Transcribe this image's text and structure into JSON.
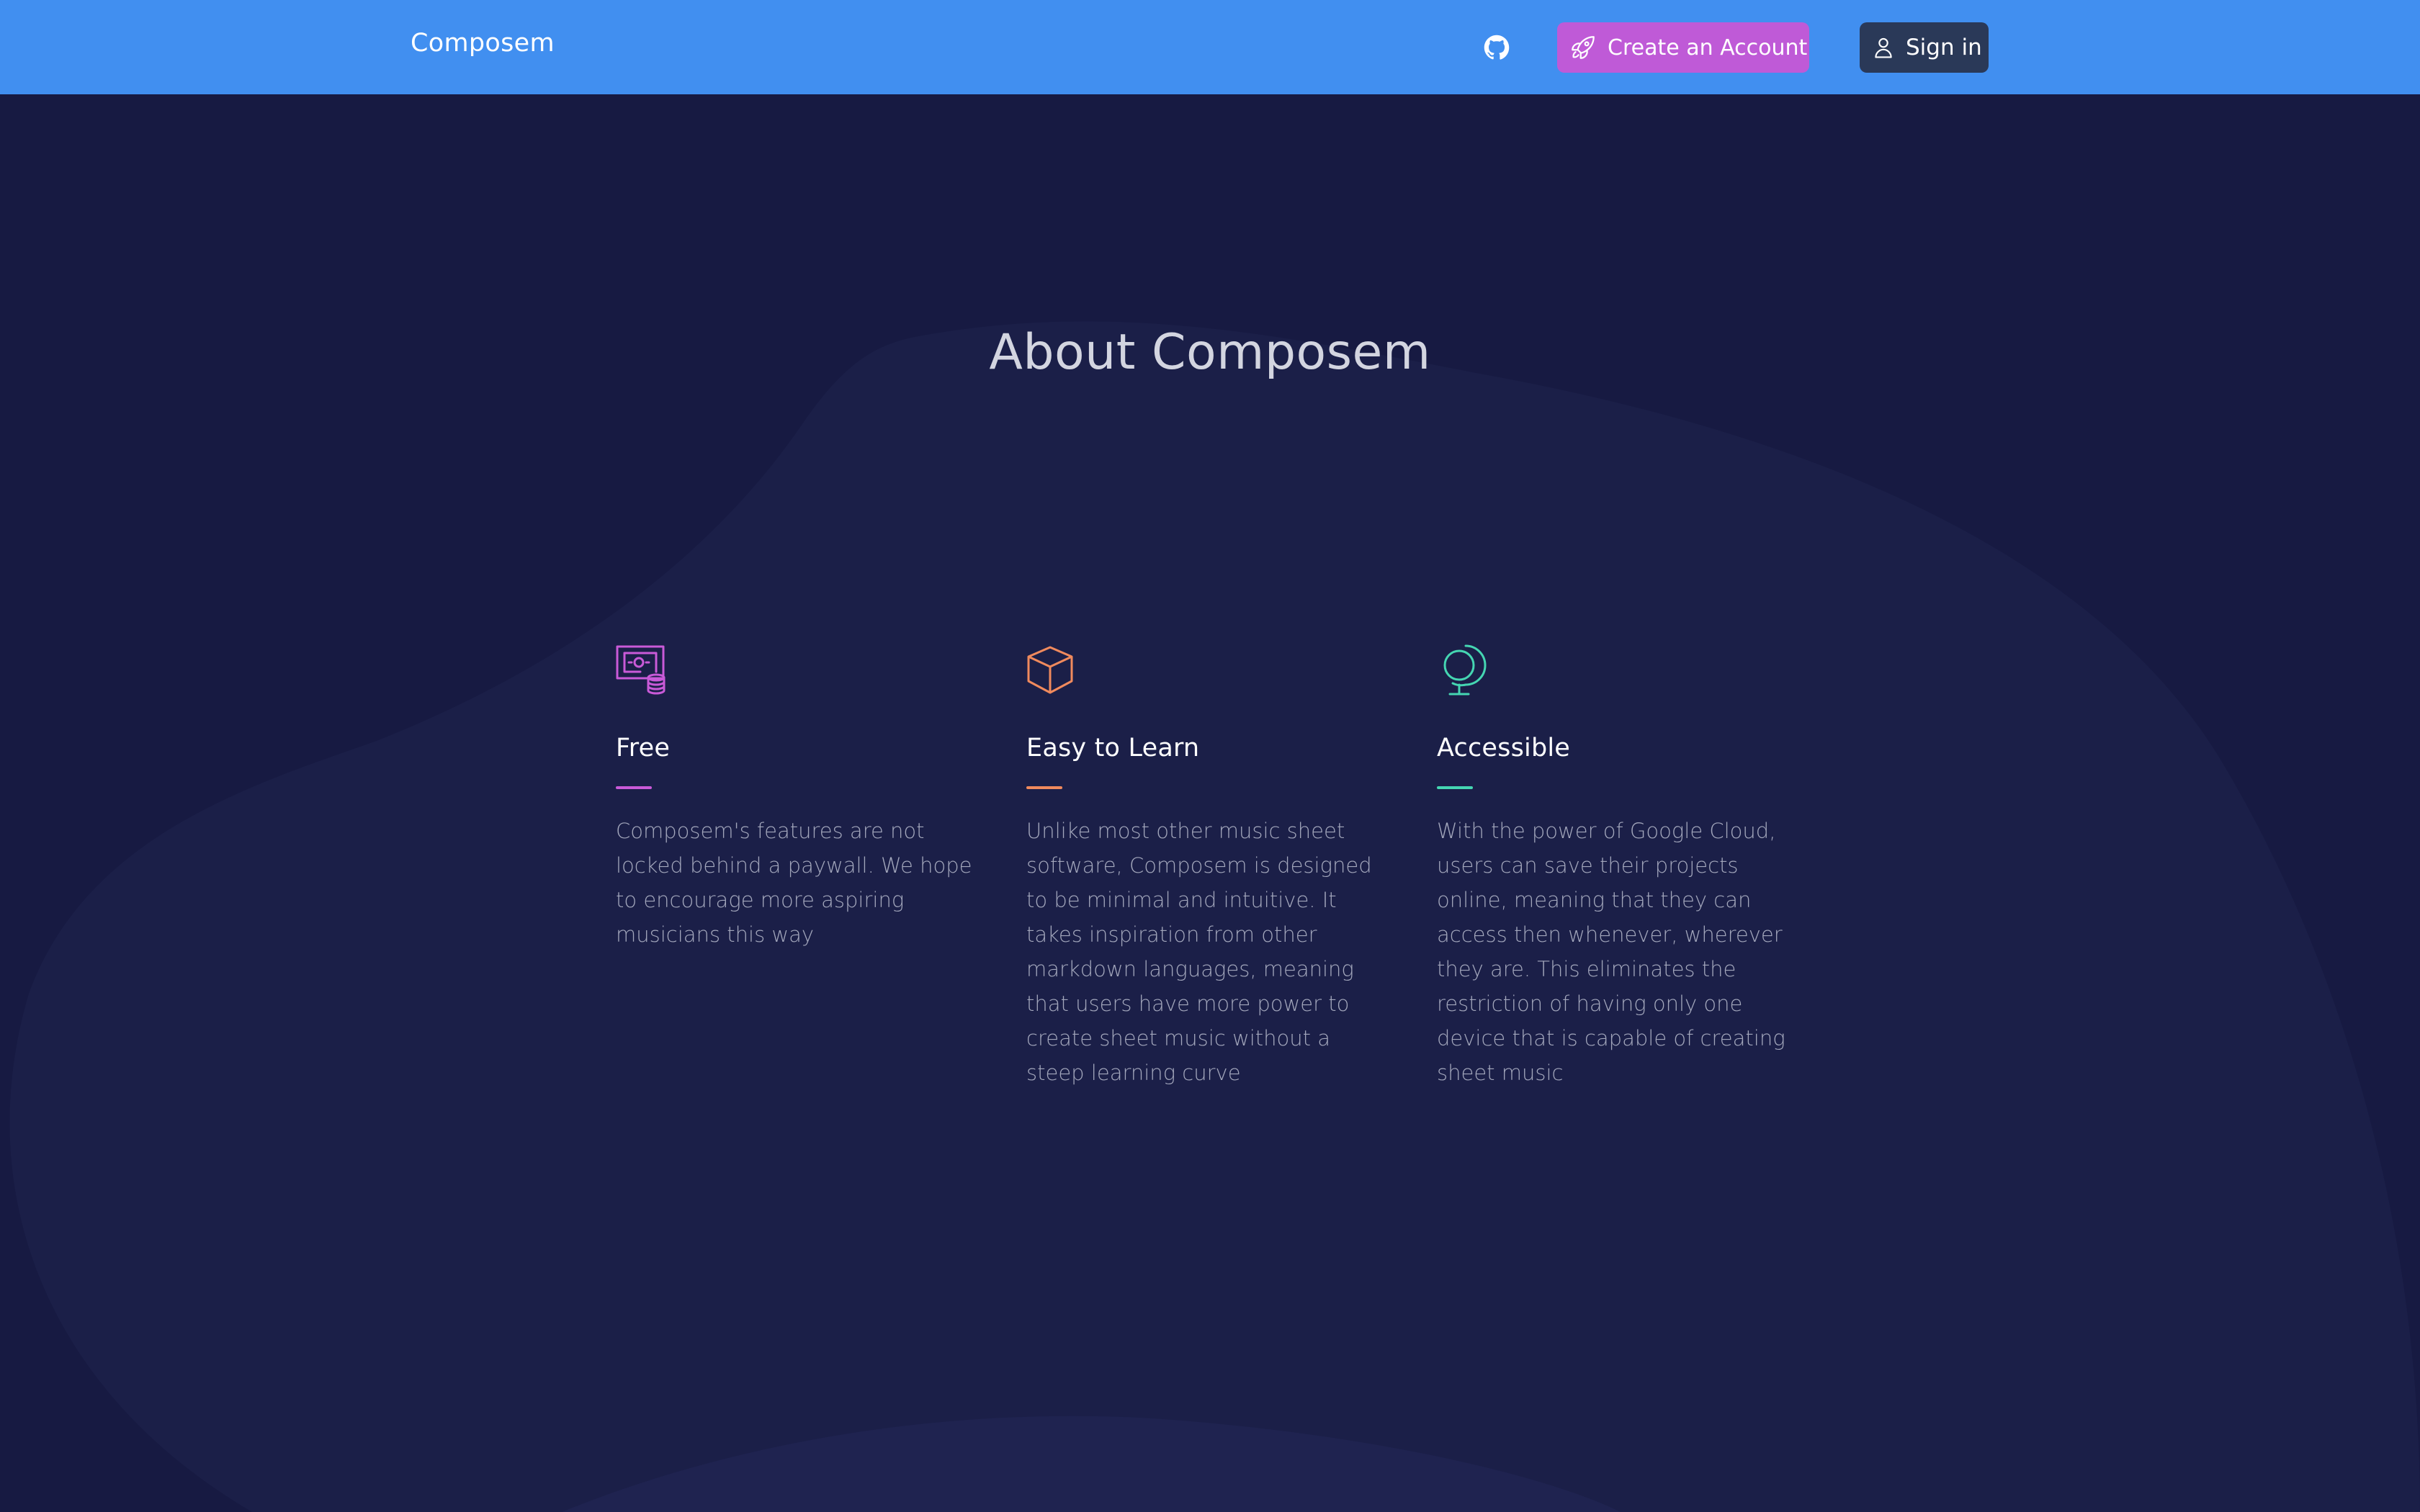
{
  "nav": {
    "brand": "Composem",
    "create_account_label": "Create an Account",
    "sign_in_label": "Sign in",
    "github_icon": "github-icon",
    "create_icon": "rocket-icon",
    "sign_in_icon": "user-icon"
  },
  "about": {
    "title": "About Composem",
    "features": [
      {
        "title": "Free",
        "text": "Composem's features are not locked behind a paywall. We hope to encourage more aspiring musicians this way",
        "icon": "cash-icon",
        "accent": "#c95ad8"
      },
      {
        "title": "Easy to Learn",
        "text": "Unlike most other music sheet software, Composem is designed to be minimal and intuitive. It takes inspiration from other markdown languages, meaning that users have more power to create sheet music without a steep learning curve",
        "icon": "cube-icon",
        "accent": "#f08a5d"
      },
      {
        "title": "Accessible",
        "text": "With the power of Google Cloud, users can save their projects online, meaning that they can access then whenever, wherever they are. This eliminates the restriction of having only one device that is capable of creating sheet music",
        "icon": "globe-icon",
        "accent": "#45d6b2"
      }
    ]
  },
  "colors": {
    "header_bg": "#418ff0",
    "page_bg": "#171a42",
    "create_button": "#bf5ad7",
    "sign_in_button": "#2a3958"
  }
}
